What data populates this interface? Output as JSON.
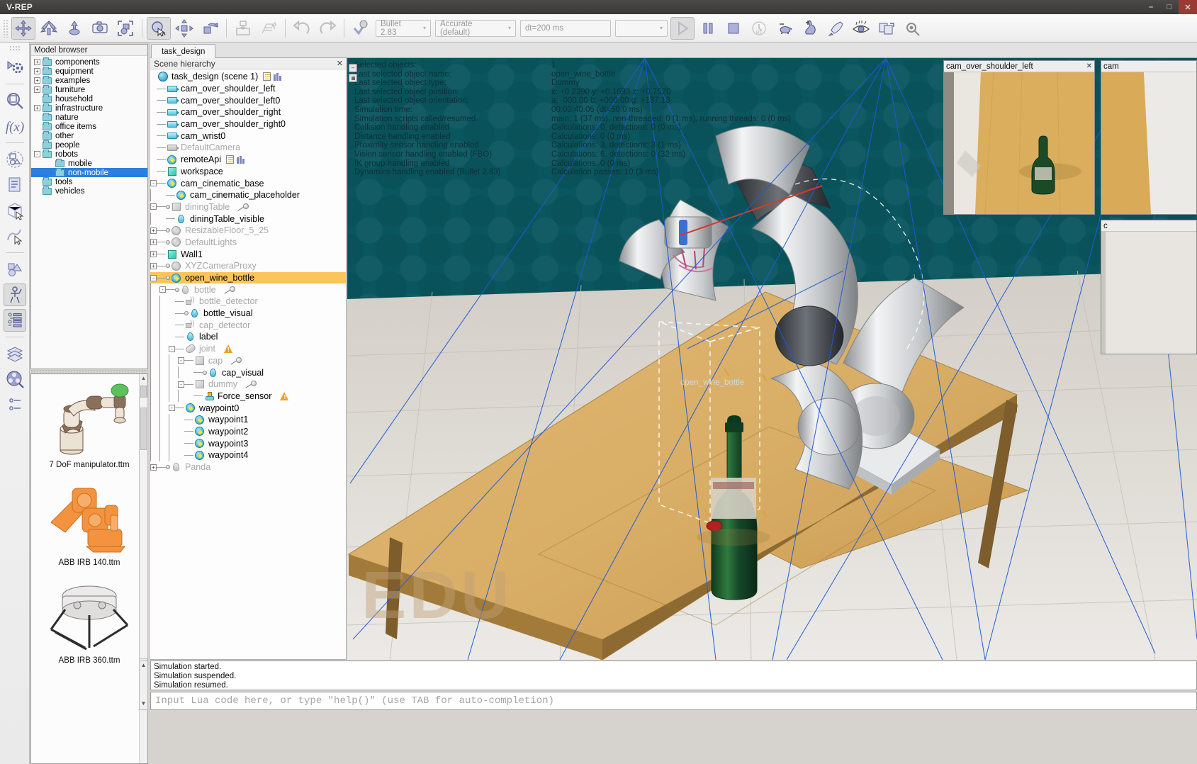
{
  "window": {
    "title": "V-REP",
    "minimize_label": "–",
    "maximize_label": "□",
    "close_label": "✕"
  },
  "toolbar": {
    "items": [
      {
        "name": "object-shift-tool",
        "tip": "Object/item shift"
      },
      {
        "name": "object-rotate-tool",
        "tip": "Object/item rotate"
      },
      {
        "name": "object-translate-tool",
        "tip": "Object translation"
      },
      {
        "name": "camera-tool",
        "tip": "Camera"
      },
      {
        "name": "select-object-tool",
        "tip": "Object selection"
      },
      {
        "name": "page-selector-tool",
        "tip": "Page selector"
      },
      {
        "name": "pan-tool",
        "tip": "Camera pan"
      },
      {
        "name": "orbit-tool",
        "tip": "Camera rotate"
      },
      {
        "name": "assemble-tool",
        "tip": "Assemble/disassemble"
      },
      {
        "name": "texture-tool",
        "tip": "Texture"
      },
      {
        "name": "undo-button",
        "tip": "Undo"
      },
      {
        "name": "redo-button",
        "tip": "Redo"
      },
      {
        "name": "dynamics-toggle",
        "tip": "Dynamics enable"
      }
    ],
    "engine_value": "Bullet 2.83",
    "accuracy_value": "Accurate (default)",
    "dt_value": "dt=200 ms",
    "extra_value": "",
    "caret": "▾",
    "playback": [
      {
        "name": "start-simulation-button",
        "label": "▷"
      },
      {
        "name": "pause-simulation-button",
        "label": "‖"
      },
      {
        "name": "stop-simulation-button",
        "label": "■"
      },
      {
        "name": "realtime-mode-button",
        "label": "RT"
      },
      {
        "name": "slow-down-button",
        "label": "turtle"
      },
      {
        "name": "speed-up-button",
        "label": "hare"
      },
      {
        "name": "threaded-rendering-button",
        "label": "rocket"
      },
      {
        "name": "visualize-button",
        "label": "eye"
      },
      {
        "name": "page-layout-button",
        "label": "pages"
      },
      {
        "name": "settings-button",
        "label": "gear"
      }
    ]
  },
  "rail": {
    "items": [
      {
        "name": "simulation-settings-icon",
        "active": false
      },
      {
        "name": "scene-object-properties-icon",
        "active": false
      },
      {
        "name": "calculation-modules-icon",
        "active": false
      },
      {
        "name": "collections-icon",
        "active": false
      },
      {
        "name": "scripts-icon",
        "active": false
      },
      {
        "name": "shape-edit-icon",
        "active": false
      },
      {
        "name": "path-edit-icon",
        "active": false
      },
      {
        "name": "geometry-icon",
        "active": false
      },
      {
        "name": "model-browser-icon",
        "active": true
      },
      {
        "name": "scene-hierarchy-icon",
        "active": true
      },
      {
        "name": "layers-icon",
        "active": false
      },
      {
        "name": "video-recorder-icon",
        "active": false
      },
      {
        "name": "user-settings-icon",
        "active": false
      }
    ]
  },
  "model_browser": {
    "header": "Model browser",
    "items": [
      {
        "label": "components",
        "expander": "+",
        "depth": 0,
        "selected": false
      },
      {
        "label": "equipment",
        "expander": "+",
        "depth": 0,
        "selected": false
      },
      {
        "label": "examples",
        "expander": "+",
        "depth": 0,
        "selected": false
      },
      {
        "label": "furniture",
        "expander": "+",
        "depth": 0,
        "selected": false
      },
      {
        "label": "household",
        "expander": "",
        "depth": 0,
        "selected": false
      },
      {
        "label": "infrastructure",
        "expander": "+",
        "depth": 0,
        "selected": false
      },
      {
        "label": "nature",
        "expander": "",
        "depth": 0,
        "selected": false
      },
      {
        "label": "office items",
        "expander": "",
        "depth": 0,
        "selected": false
      },
      {
        "label": "other",
        "expander": "",
        "depth": 0,
        "selected": false
      },
      {
        "label": "people",
        "expander": "",
        "depth": 0,
        "selected": false
      },
      {
        "label": "robots",
        "expander": "-",
        "depth": 0,
        "selected": false
      },
      {
        "label": "mobile",
        "expander": "",
        "depth": 1,
        "selected": false
      },
      {
        "label": "non-mobile",
        "expander": "",
        "depth": 1,
        "selected": true
      },
      {
        "label": "tools",
        "expander": "",
        "depth": 0,
        "selected": false
      },
      {
        "label": "vehicles",
        "expander": "",
        "depth": 0,
        "selected": false
      }
    ]
  },
  "model_list": {
    "items": [
      {
        "caption": "7 DoF manipulator.ttm",
        "thumb": "7dof-manipulator-thumbnail"
      },
      {
        "caption": "ABB IRB 140.ttm",
        "thumb": "abb-irb-140-thumbnail"
      },
      {
        "caption": "ABB IRB 360.ttm",
        "thumb": "abb-irb-360-thumbnail"
      }
    ]
  },
  "scene_tab": {
    "label": "task_design"
  },
  "hierarchy": {
    "header": "Scene hierarchy",
    "close_label": "✕",
    "root": "task_design (scene 1)",
    "items": [
      {
        "label": "cam_over_shoulder_left",
        "depth": 1,
        "icon": "camera-icon",
        "dim": false,
        "expander": "",
        "sel": false
      },
      {
        "label": "cam_over_shoulder_left0",
        "depth": 1,
        "icon": "camera-icon",
        "dim": false,
        "expander": "",
        "sel": false
      },
      {
        "label": "cam_over_shoulder_right",
        "depth": 1,
        "icon": "camera-icon",
        "dim": false,
        "expander": "",
        "sel": false
      },
      {
        "label": "cam_over_shoulder_right0",
        "depth": 1,
        "icon": "camera-icon",
        "dim": false,
        "expander": "",
        "sel": false
      },
      {
        "label": "cam_wrist0",
        "depth": 1,
        "icon": "camera-icon",
        "dim": false,
        "expander": "",
        "sel": false
      },
      {
        "label": "DefaultCamera",
        "depth": 1,
        "icon": "camera-icon",
        "dim": true,
        "expander": "",
        "sel": false
      },
      {
        "label": "remoteApi",
        "depth": 1,
        "icon": "dummy-icon",
        "dim": false,
        "expander": "",
        "sel": false,
        "script": true
      },
      {
        "label": "workspace",
        "depth": 1,
        "icon": "shape-icon",
        "dim": false,
        "expander": "",
        "sel": false
      },
      {
        "label": "cam_cinematic_base",
        "depth": 1,
        "icon": "dummy-icon",
        "dim": false,
        "expander": "-",
        "sel": false
      },
      {
        "label": "cam_cinematic_placeholder",
        "depth": 2,
        "icon": "dummy-icon",
        "dim": false,
        "expander": "",
        "sel": false
      },
      {
        "label": "diningTable",
        "depth": 1,
        "icon": "shape-icon",
        "dim": true,
        "expander": "-",
        "sel": false,
        "dot": true,
        "child": true
      },
      {
        "label": "diningTable_visible",
        "depth": 2,
        "icon": "drop-icon",
        "dim": false,
        "expander": "",
        "sel": false
      },
      {
        "label": "ResizableFloor_5_25",
        "depth": 1,
        "icon": "dummy-icon",
        "dim": true,
        "expander": "+",
        "sel": false,
        "dot": true
      },
      {
        "label": "DefaultLights",
        "depth": 1,
        "icon": "dummy-icon",
        "dim": true,
        "expander": "+",
        "sel": false,
        "dot": true
      },
      {
        "label": "Wall1",
        "depth": 1,
        "icon": "shape-icon",
        "dim": false,
        "expander": "+",
        "sel": false
      },
      {
        "label": "XYZCameraProxy",
        "depth": 1,
        "icon": "dummy-icon",
        "dim": true,
        "expander": "+",
        "sel": false,
        "dot": true
      },
      {
        "label": "open_wine_bottle",
        "depth": 1,
        "icon": "dummy-icon",
        "dim": false,
        "expander": "-",
        "sel": true,
        "dot": true
      },
      {
        "label": "bottle",
        "depth": 2,
        "icon": "drop-icon",
        "dim": true,
        "expander": "-",
        "sel": false,
        "dot": true,
        "child": true
      },
      {
        "label": "bottle_detector",
        "depth": 3,
        "icon": "proximity-icon",
        "dim": true,
        "expander": "",
        "sel": false
      },
      {
        "label": "bottle_visual",
        "depth": 3,
        "icon": "drop-icon",
        "dim": false,
        "expander": "",
        "sel": false,
        "dot": true
      },
      {
        "label": "cap_detector",
        "depth": 3,
        "icon": "proximity-icon",
        "dim": true,
        "expander": "",
        "sel": false
      },
      {
        "label": "label",
        "depth": 3,
        "icon": "drop-icon",
        "dim": false,
        "expander": "",
        "sel": false
      },
      {
        "label": "joint",
        "depth": 3,
        "icon": "joint-icon",
        "dim": true,
        "expander": "-",
        "sel": false,
        "warn": true
      },
      {
        "label": "cap",
        "depth": 4,
        "icon": "shape-icon",
        "dim": true,
        "expander": "-",
        "sel": false,
        "child": true
      },
      {
        "label": "cap_visual",
        "depth": 5,
        "icon": "drop-icon",
        "dim": false,
        "expander": "",
        "sel": false,
        "dot": true
      },
      {
        "label": "dummy",
        "depth": 4,
        "icon": "shape-icon",
        "dim": true,
        "expander": "-",
        "sel": false,
        "child": true
      },
      {
        "label": "Force_sensor",
        "depth": 5,
        "icon": "force-icon",
        "dim": false,
        "expander": "",
        "sel": false,
        "warn": true
      },
      {
        "label": "waypoint0",
        "depth": 3,
        "icon": "dummy-icon",
        "dim": false,
        "expander": "-",
        "sel": false
      },
      {
        "label": "waypoint1",
        "depth": 4,
        "icon": "dummy-icon",
        "dim": false,
        "expander": "",
        "sel": false
      },
      {
        "label": "waypoint2",
        "depth": 4,
        "icon": "dummy-icon",
        "dim": false,
        "expander": "",
        "sel": false
      },
      {
        "label": "waypoint3",
        "depth": 4,
        "icon": "dummy-icon",
        "dim": false,
        "expander": "",
        "sel": false
      },
      {
        "label": "waypoint4",
        "depth": 4,
        "icon": "dummy-icon",
        "dim": false,
        "expander": "",
        "sel": false
      },
      {
        "label": "Panda",
        "depth": 1,
        "icon": "drop-icon",
        "dim": true,
        "expander": "+",
        "sel": false,
        "dot": true
      }
    ]
  },
  "viewport": {
    "info_rows": [
      {
        "key": "Selected objects:",
        "value": "1"
      },
      {
        "key": "Last selected object name:",
        "value": "open_wine_bottle"
      },
      {
        "key": "Last selected object type:",
        "value": "Dummy"
      },
      {
        "key": "Last selected object position:",
        "value": "x: +0.2390    y: +0.1693    z: +0.7520"
      },
      {
        "key": "Last selected object orientation:",
        "value": "a: -000.00    b: +000.00    g: +137.13"
      },
      {
        "key": "Simulation time:",
        "value": "00:00:40.05 (dt=50.0 ms)"
      },
      {
        "key": "Simulation scripts called/resumed",
        "value": "main: 1 (37 ms), non-threaded: 0 (1 ms), running threads: 0 (0 ms)"
      },
      {
        "key": "Collision handling enabled",
        "value": "Calculations: 0, detections: 0 (0 ms)"
      },
      {
        "key": "Distance handling enabled",
        "value": "Calculations: 0 (0 ms)"
      },
      {
        "key": "Proximity sensor handling enabled",
        "value": "Calculations: 3, detections: 3 (1 ms)"
      },
      {
        "key": "Vision sensor handling enabled (FBO)",
        "value": "Calculations: 6, detections: 0 (32 ms)"
      },
      {
        "key": "IK group handling enabled",
        "value": "Calculations: 0 (0 ms)"
      },
      {
        "key": "Dynamics handling enabled (Bullet 2.83)",
        "value": "Calculation passes: 10 (3 ms)"
      }
    ],
    "collapse_label": "–",
    "watermark": "EDU",
    "scene_object_label": "open_wine_bottle"
  },
  "camera_views": [
    {
      "name": "cam-over-shoulder-left-window",
      "title": "cam_over_shoulder_left",
      "close_label": "✕"
    },
    {
      "name": "cam-over-shoulder-right-window",
      "title": "cam",
      "close_label": "✕"
    },
    {
      "name": "cam-wrist-window",
      "title": "c",
      "close_label": ""
    }
  ],
  "status": {
    "lines": [
      "Simulation started.",
      "Simulation suspended.",
      "Simulation resumed."
    ]
  },
  "console": {
    "value": "",
    "placeholder": "Input Lua code here, or type \"help()\" (use TAB for auto-completion)"
  },
  "colors": {
    "selection_highlight": "#fbc55a",
    "tree_selected": "#2a7fe0",
    "viewport_bg": "#0a565f",
    "accent": "#7d86c0"
  }
}
